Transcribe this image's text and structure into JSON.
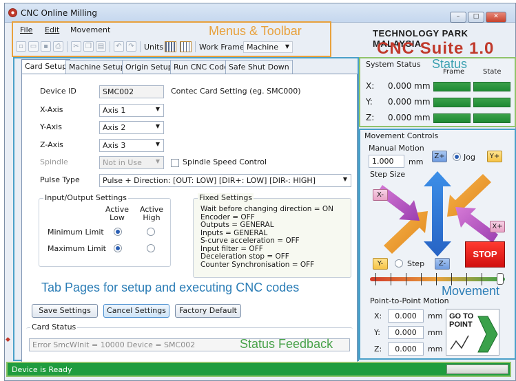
{
  "window": {
    "title": "CNC Online Milling",
    "min": "–",
    "max": "□",
    "close": "✕"
  },
  "menu": {
    "file": "File",
    "edit": "Edit",
    "movement": "Movement"
  },
  "toolbar": {
    "units": "Units",
    "work_frame": "Work Frame",
    "machine": "Machine"
  },
  "annotations": {
    "menus_toolbar": "Menus & Toolbar",
    "status": "Status",
    "movement": "Movement",
    "tab_pages": "Tab Pages for setup and executing CNC codes",
    "status_feedback": "Status Feedback"
  },
  "brand": {
    "org": "TECHNOLOGY PARK MALAYSIA",
    "product": "CNC Suite 1.0"
  },
  "tabs": [
    "Card Setup",
    "Machine Setup",
    "Origin Setup",
    "Run CNC Codes",
    "Safe Shut Down"
  ],
  "card_setup": {
    "device_id_label": "Device ID",
    "device_id_value": "SMC002",
    "device_hint": "Contec Card Setting (eg. SMC000)",
    "x_axis_label": "X-Axis",
    "x_axis_value": "Axis 1",
    "y_axis_label": "Y-Axis",
    "y_axis_value": "Axis 2",
    "z_axis_label": "Z-Axis",
    "z_axis_value": "Axis 3",
    "spindle_label": "Spindle",
    "spindle_value": "Not in Use",
    "spindle_speed_control": "Spindle Speed Control",
    "pulse_type_label": "Pulse Type",
    "pulse_type_value": "Pulse + Direction: [OUT: LOW] [DIR+: LOW] [DIR-: HIGH]",
    "io_settings": {
      "title": "Input/Output Settings",
      "active_low": "Active\nLow",
      "active_high": "Active\nHigh",
      "min_limit": "Minimum Limit",
      "max_limit": "Maximum Limit"
    },
    "fixed_settings": {
      "title": "Fixed Settings",
      "lines": [
        "Wait before changing direction = ON",
        "Encoder = OFF",
        "Outputs = GENERAL",
        "Inputs = GENERAL",
        "S-curve acceleration = OFF",
        "Input filter = OFF",
        "Deceleration stop = OFF",
        "Counter Synchronisation = OFF"
      ]
    },
    "buttons": {
      "save": "Save Settings",
      "cancel": "Cancel Settings",
      "factory": "Factory Default"
    },
    "card_status_title": "Card Status",
    "card_status_value": "Error SmcWInit = 10000 Device = SMC002"
  },
  "system_status": {
    "title": "System Status",
    "frame": "Frame",
    "state": "State",
    "axes": [
      {
        "label": "X:",
        "value": "0.000 mm"
      },
      {
        "label": "Y:",
        "value": "0.000 mm"
      },
      {
        "label": "Z:",
        "value": "0.000 mm"
      }
    ]
  },
  "movement_controls": {
    "title": "Movement Controls",
    "manual_motion": "Manual Motion",
    "step_value": "1.000",
    "unit": "mm",
    "step_size": "Step Size",
    "jog": "Jog",
    "step": "Step",
    "z_plus": "Z+",
    "z_minus": "Z-",
    "y_plus": "Y+",
    "y_minus": "Y-",
    "x_plus": "X+",
    "x_minus": "X-",
    "stop": "STOP",
    "jog_selected": true
  },
  "point_to_point": {
    "title": "Point-to-Point Motion",
    "rows": [
      {
        "label": "X:",
        "value": "0.000",
        "unit": "mm"
      },
      {
        "label": "Y:",
        "value": "0.000",
        "unit": "mm"
      },
      {
        "label": "Z:",
        "value": "0.000",
        "unit": "mm"
      }
    ],
    "goto": "GO TO\nPOINT"
  },
  "statusbar": {
    "text": "Device is Ready",
    "progress": 0
  },
  "colors": {
    "accent_orange": "#e8a13c",
    "status_green": "#1f9c3e",
    "brand_red": "#c0392b",
    "stop_red": "#e01b16"
  }
}
